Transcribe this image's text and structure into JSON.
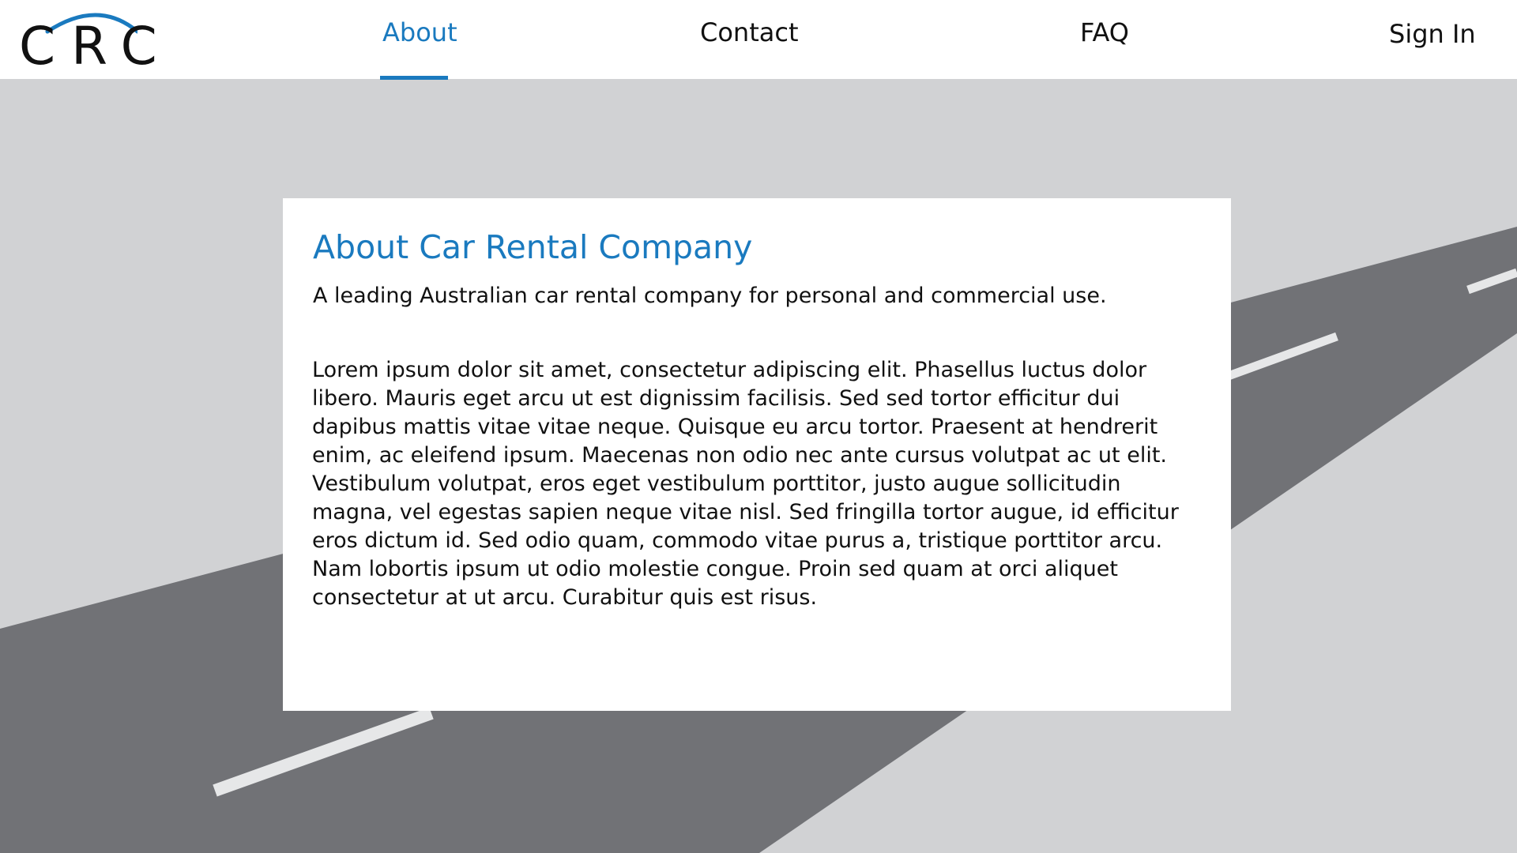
{
  "header": {
    "logo_text": "CRC",
    "nav": [
      {
        "label": "About",
        "active": true
      },
      {
        "label": "Contact",
        "active": false
      },
      {
        "label": "FAQ",
        "active": false
      }
    ],
    "sign_in_label": "Sign In"
  },
  "card": {
    "title": "About Car Rental Company",
    "subtitle": "A leading Australian car rental company for personal and commercial use.",
    "body": "Lorem ipsum dolor sit amet, consectetur adipiscing elit. Phasellus luctus dolor libero. Mauris eget arcu ut est dignissim facilisis. Sed sed tortor efficitur dui dapibus mattis vitae vitae neque. Quisque eu arcu tortor. Praesent at hendrerit enim, ac eleifend ipsum. Maecenas non odio nec ante cursus volutpat ac ut elit. Vestibulum volutpat, eros eget vestibulum porttitor, justo augue sollicitudin magna, vel egestas sapien neque vitae nisl. Sed fringilla tortor augue, id efficitur eros dictum id. Sed odio quam, commodo vitae purus a, tristique porttitor arcu. Nam lobortis ipsum ut odio molestie congue. Proin sed quam at orci aliquet consectetur at ut arcu. Curabitur quis est risus."
  },
  "colors": {
    "accent": "#1a7abf",
    "background": "#d1d2d4",
    "road": "#717276",
    "road_marking": "#e6e7e8",
    "card": "#ffffff",
    "text": "#111111"
  }
}
